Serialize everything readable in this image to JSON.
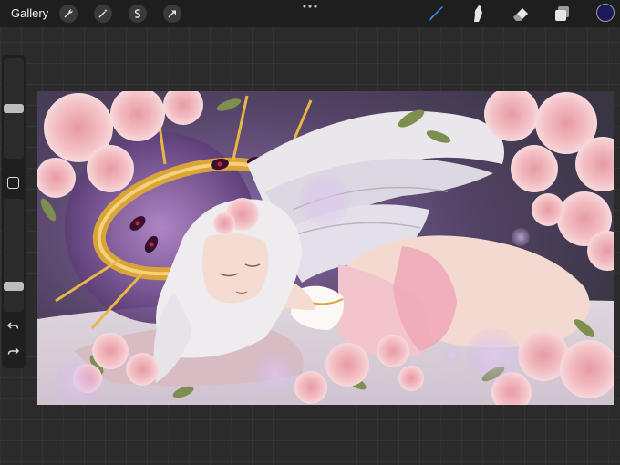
{
  "topbar": {
    "gallery_label": "Gallery",
    "left_tools": [
      "wrench-icon",
      "magic-wand-icon",
      "selection-icon",
      "transform-arrow-icon"
    ],
    "menu_icon": "more-dots-icon",
    "right_tools": [
      "brush-icon",
      "smudge-icon",
      "eraser-icon",
      "layers-icon"
    ],
    "active_tool": "brush-icon",
    "current_color": "#1b1a5c",
    "accent_color": "#3b8cff"
  },
  "sidebar": {
    "size_slider_level": 0.5,
    "opacity_slider_level": 0.2,
    "icons": [
      "modify-square-icon",
      "undo-icon",
      "redo-icon"
    ]
  },
  "canvas": {
    "artwork": "illustration"
  }
}
